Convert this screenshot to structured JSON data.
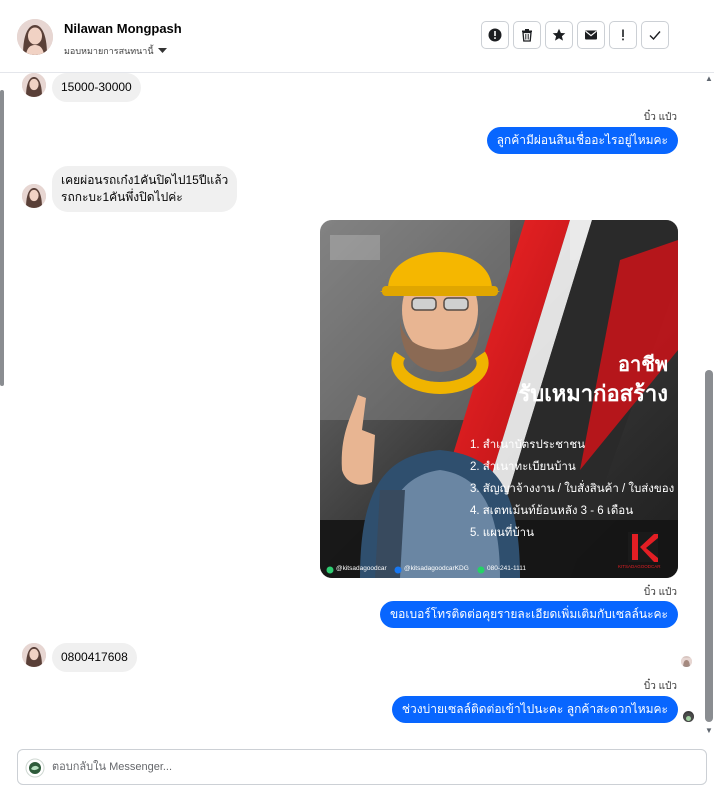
{
  "header": {
    "contact_name": "Nilawan Mongpash",
    "assign_label": "มอบหมายการสนทนานี้"
  },
  "toolbar": {
    "buttons": [
      {
        "icon": "alert-circle-icon",
        "label": "Mark as spam"
      },
      {
        "icon": "trash-icon",
        "label": "Delete"
      },
      {
        "icon": "star-icon",
        "label": "Star"
      },
      {
        "icon": "envelope-icon",
        "label": "Mark as unread"
      },
      {
        "icon": "exclamation-icon",
        "label": "Follow up"
      },
      {
        "icon": "check-icon",
        "label": "Mark as done"
      }
    ]
  },
  "messages": {
    "m1": "15000-30000",
    "sender1": "บิ๋ว แป๋ว",
    "m2": "ลูกค้ามีผ่อนสินเชื่ออะไรอยู่ไหมคะ",
    "m3_line1": "เคยผ่อนรถเก๋ง1คันปิดไป15ปีแล้ว",
    "m3_line2": "รถกะบะ1คันพึ่งปิดไปค่ะ",
    "promo": {
      "headline1": "อาชีพ",
      "headline2": "รับเหมาก่อสร้าง",
      "items": [
        "1. สำเนาบัตรประชาชน",
        "2. สำเนาทะเบียนบ้าน",
        "3. สัญญาจ้างงาน / ใบสั่งสินค้า / ใบส่งของ",
        "4. สเตทเม้นท์ย้อนหลัง 3 - 6 เดือน",
        "5. แผนที่บ้าน"
      ],
      "footer_line": "@kitsadagoodcar",
      "footer_facebook": "@kitsadagoodcarKDG",
      "footer_phone": "080-241-1111",
      "brand_letter": "K",
      "brand_name": "KITSADAGOODCAR"
    },
    "sender2": "บิ๋ว แป๋ว",
    "m4": "ขอเบอร์โทรติดต่อคุยรายละเอียดเพิ่มเติมกับเซลล์นะคะ",
    "m5": "0800417608",
    "sender3": "บิ๋ว แป๋ว",
    "m6": "ช่วงบ่ายเซลล์ติดต่อเข้าไปนะคะ  ลูกค้าสะดวกไหมคะ"
  },
  "composer": {
    "placeholder": "ตอบกลับใน Messenger..."
  },
  "colors": {
    "accent": "#0866ff",
    "incoming_bubble": "#f0f0f0",
    "promo_red": "#e31e24"
  }
}
